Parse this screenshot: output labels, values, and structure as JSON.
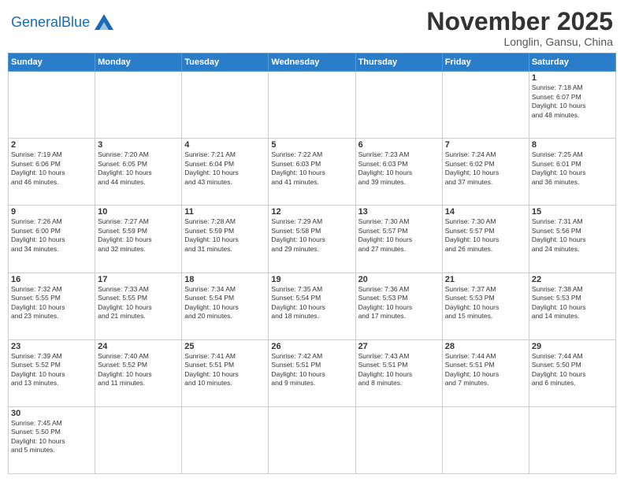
{
  "header": {
    "logo_general": "General",
    "logo_blue": "Blue",
    "month_title": "November 2025",
    "location": "Longlin, Gansu, China"
  },
  "weekdays": [
    "Sunday",
    "Monday",
    "Tuesday",
    "Wednesday",
    "Thursday",
    "Friday",
    "Saturday"
  ],
  "weeks": [
    [
      {
        "day": "",
        "info": ""
      },
      {
        "day": "",
        "info": ""
      },
      {
        "day": "",
        "info": ""
      },
      {
        "day": "",
        "info": ""
      },
      {
        "day": "",
        "info": ""
      },
      {
        "day": "",
        "info": ""
      },
      {
        "day": "1",
        "info": "Sunrise: 7:18 AM\nSunset: 6:07 PM\nDaylight: 10 hours\nand 48 minutes."
      }
    ],
    [
      {
        "day": "2",
        "info": "Sunrise: 7:19 AM\nSunset: 6:06 PM\nDaylight: 10 hours\nand 46 minutes."
      },
      {
        "day": "3",
        "info": "Sunrise: 7:20 AM\nSunset: 6:05 PM\nDaylight: 10 hours\nand 44 minutes."
      },
      {
        "day": "4",
        "info": "Sunrise: 7:21 AM\nSunset: 6:04 PM\nDaylight: 10 hours\nand 43 minutes."
      },
      {
        "day": "5",
        "info": "Sunrise: 7:22 AM\nSunset: 6:03 PM\nDaylight: 10 hours\nand 41 minutes."
      },
      {
        "day": "6",
        "info": "Sunrise: 7:23 AM\nSunset: 6:03 PM\nDaylight: 10 hours\nand 39 minutes."
      },
      {
        "day": "7",
        "info": "Sunrise: 7:24 AM\nSunset: 6:02 PM\nDaylight: 10 hours\nand 37 minutes."
      },
      {
        "day": "8",
        "info": "Sunrise: 7:25 AM\nSunset: 6:01 PM\nDaylight: 10 hours\nand 36 minutes."
      }
    ],
    [
      {
        "day": "9",
        "info": "Sunrise: 7:26 AM\nSunset: 6:00 PM\nDaylight: 10 hours\nand 34 minutes."
      },
      {
        "day": "10",
        "info": "Sunrise: 7:27 AM\nSunset: 5:59 PM\nDaylight: 10 hours\nand 32 minutes."
      },
      {
        "day": "11",
        "info": "Sunrise: 7:28 AM\nSunset: 5:59 PM\nDaylight: 10 hours\nand 31 minutes."
      },
      {
        "day": "12",
        "info": "Sunrise: 7:29 AM\nSunset: 5:58 PM\nDaylight: 10 hours\nand 29 minutes."
      },
      {
        "day": "13",
        "info": "Sunrise: 7:30 AM\nSunset: 5:57 PM\nDaylight: 10 hours\nand 27 minutes."
      },
      {
        "day": "14",
        "info": "Sunrise: 7:30 AM\nSunset: 5:57 PM\nDaylight: 10 hours\nand 26 minutes."
      },
      {
        "day": "15",
        "info": "Sunrise: 7:31 AM\nSunset: 5:56 PM\nDaylight: 10 hours\nand 24 minutes."
      }
    ],
    [
      {
        "day": "16",
        "info": "Sunrise: 7:32 AM\nSunset: 5:55 PM\nDaylight: 10 hours\nand 23 minutes."
      },
      {
        "day": "17",
        "info": "Sunrise: 7:33 AM\nSunset: 5:55 PM\nDaylight: 10 hours\nand 21 minutes."
      },
      {
        "day": "18",
        "info": "Sunrise: 7:34 AM\nSunset: 5:54 PM\nDaylight: 10 hours\nand 20 minutes."
      },
      {
        "day": "19",
        "info": "Sunrise: 7:35 AM\nSunset: 5:54 PM\nDaylight: 10 hours\nand 18 minutes."
      },
      {
        "day": "20",
        "info": "Sunrise: 7:36 AM\nSunset: 5:53 PM\nDaylight: 10 hours\nand 17 minutes."
      },
      {
        "day": "21",
        "info": "Sunrise: 7:37 AM\nSunset: 5:53 PM\nDaylight: 10 hours\nand 15 minutes."
      },
      {
        "day": "22",
        "info": "Sunrise: 7:38 AM\nSunset: 5:53 PM\nDaylight: 10 hours\nand 14 minutes."
      }
    ],
    [
      {
        "day": "23",
        "info": "Sunrise: 7:39 AM\nSunset: 5:52 PM\nDaylight: 10 hours\nand 13 minutes."
      },
      {
        "day": "24",
        "info": "Sunrise: 7:40 AM\nSunset: 5:52 PM\nDaylight: 10 hours\nand 11 minutes."
      },
      {
        "day": "25",
        "info": "Sunrise: 7:41 AM\nSunset: 5:51 PM\nDaylight: 10 hours\nand 10 minutes."
      },
      {
        "day": "26",
        "info": "Sunrise: 7:42 AM\nSunset: 5:51 PM\nDaylight: 10 hours\nand 9 minutes."
      },
      {
        "day": "27",
        "info": "Sunrise: 7:43 AM\nSunset: 5:51 PM\nDaylight: 10 hours\nand 8 minutes."
      },
      {
        "day": "28",
        "info": "Sunrise: 7:44 AM\nSunset: 5:51 PM\nDaylight: 10 hours\nand 7 minutes."
      },
      {
        "day": "29",
        "info": "Sunrise: 7:44 AM\nSunset: 5:50 PM\nDaylight: 10 hours\nand 6 minutes."
      }
    ],
    [
      {
        "day": "30",
        "info": "Sunrise: 7:45 AM\nSunset: 5:50 PM\nDaylight: 10 hours\nand 5 minutes."
      },
      {
        "day": "",
        "info": ""
      },
      {
        "day": "",
        "info": ""
      },
      {
        "day": "",
        "info": ""
      },
      {
        "day": "",
        "info": ""
      },
      {
        "day": "",
        "info": ""
      },
      {
        "day": "",
        "info": ""
      }
    ]
  ]
}
